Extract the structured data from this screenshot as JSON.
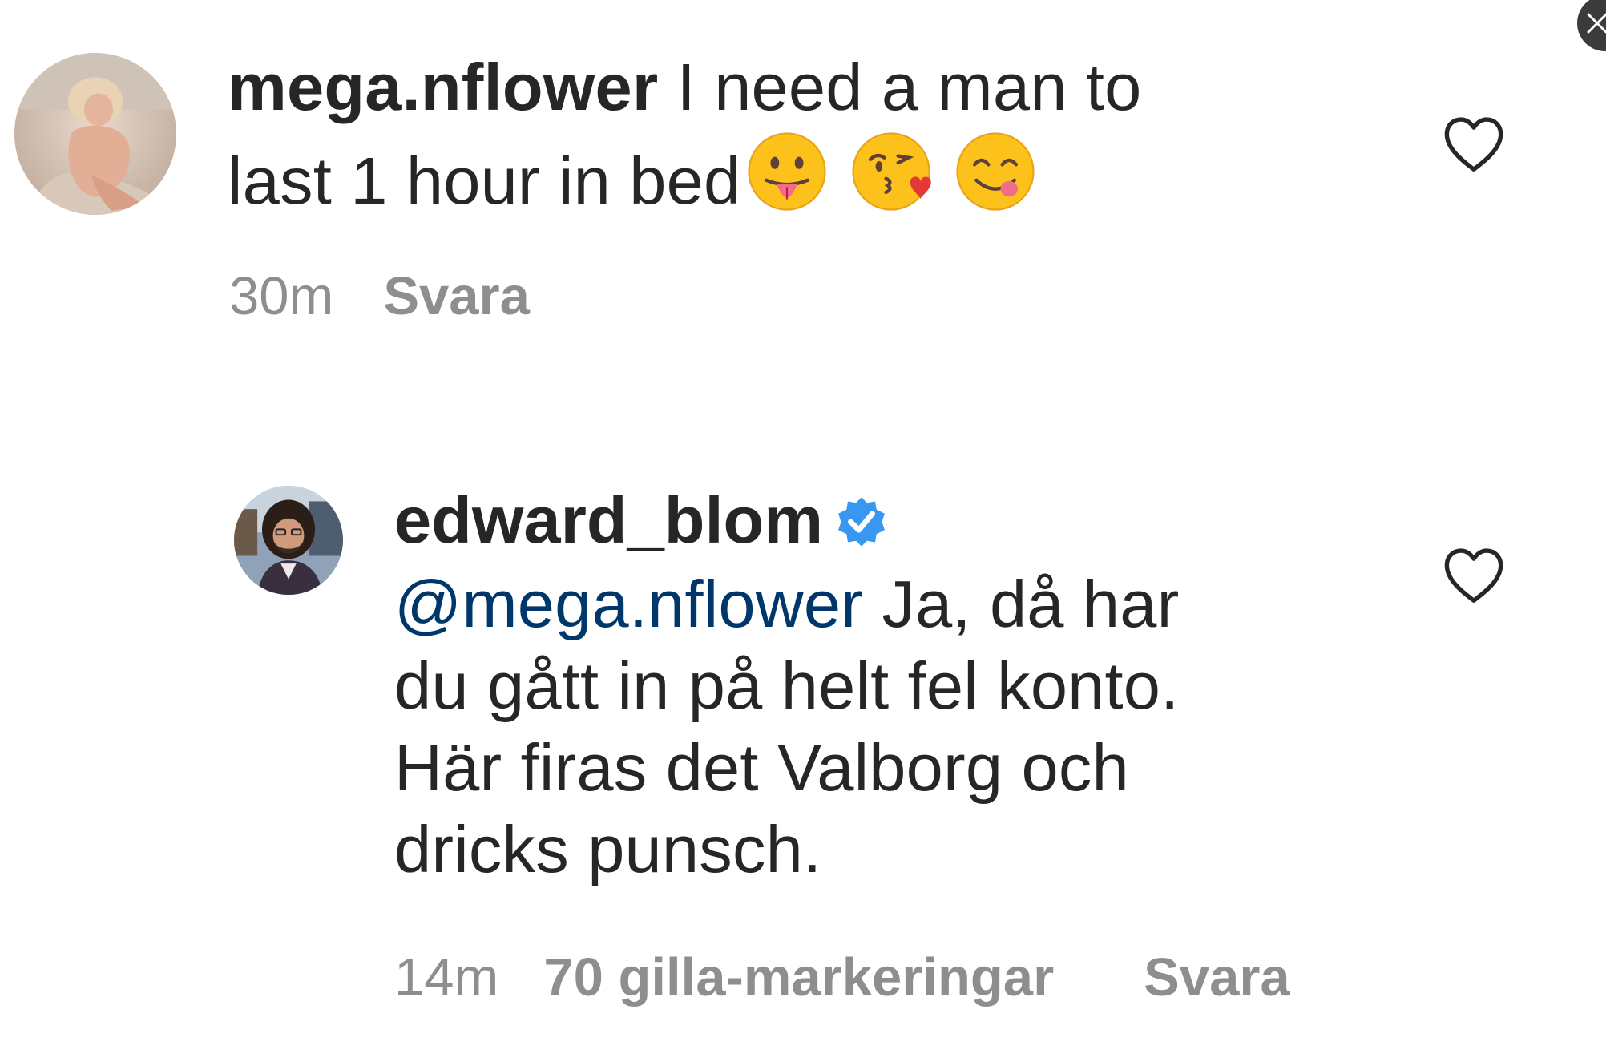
{
  "comments": [
    {
      "username": "mega.nflower",
      "text_line1": "I need a man to",
      "text_line2": "last 1 hour in bed",
      "emojis": [
        "tongue-face-emoji",
        "kissing-heart-emoji",
        "yum-face-emoji"
      ],
      "time": "30m",
      "reply_label": "Svara",
      "liked": false
    },
    {
      "username": "edward_blom",
      "verified": true,
      "mention": "@mega.nflower",
      "text_line1": " Ja, då har",
      "text_line2": "du gått in på helt fel konto.",
      "text_line3": "Här firas det Valborg och",
      "text_line4": "dricks punsch.",
      "time": "14m",
      "likes_label": "70 gilla-markeringar",
      "reply_label": "Svara",
      "liked": false
    }
  ],
  "colors": {
    "text": "#262626",
    "meta": "#8e8e8e",
    "mention": "#00376b",
    "verified": "#3897f0"
  }
}
